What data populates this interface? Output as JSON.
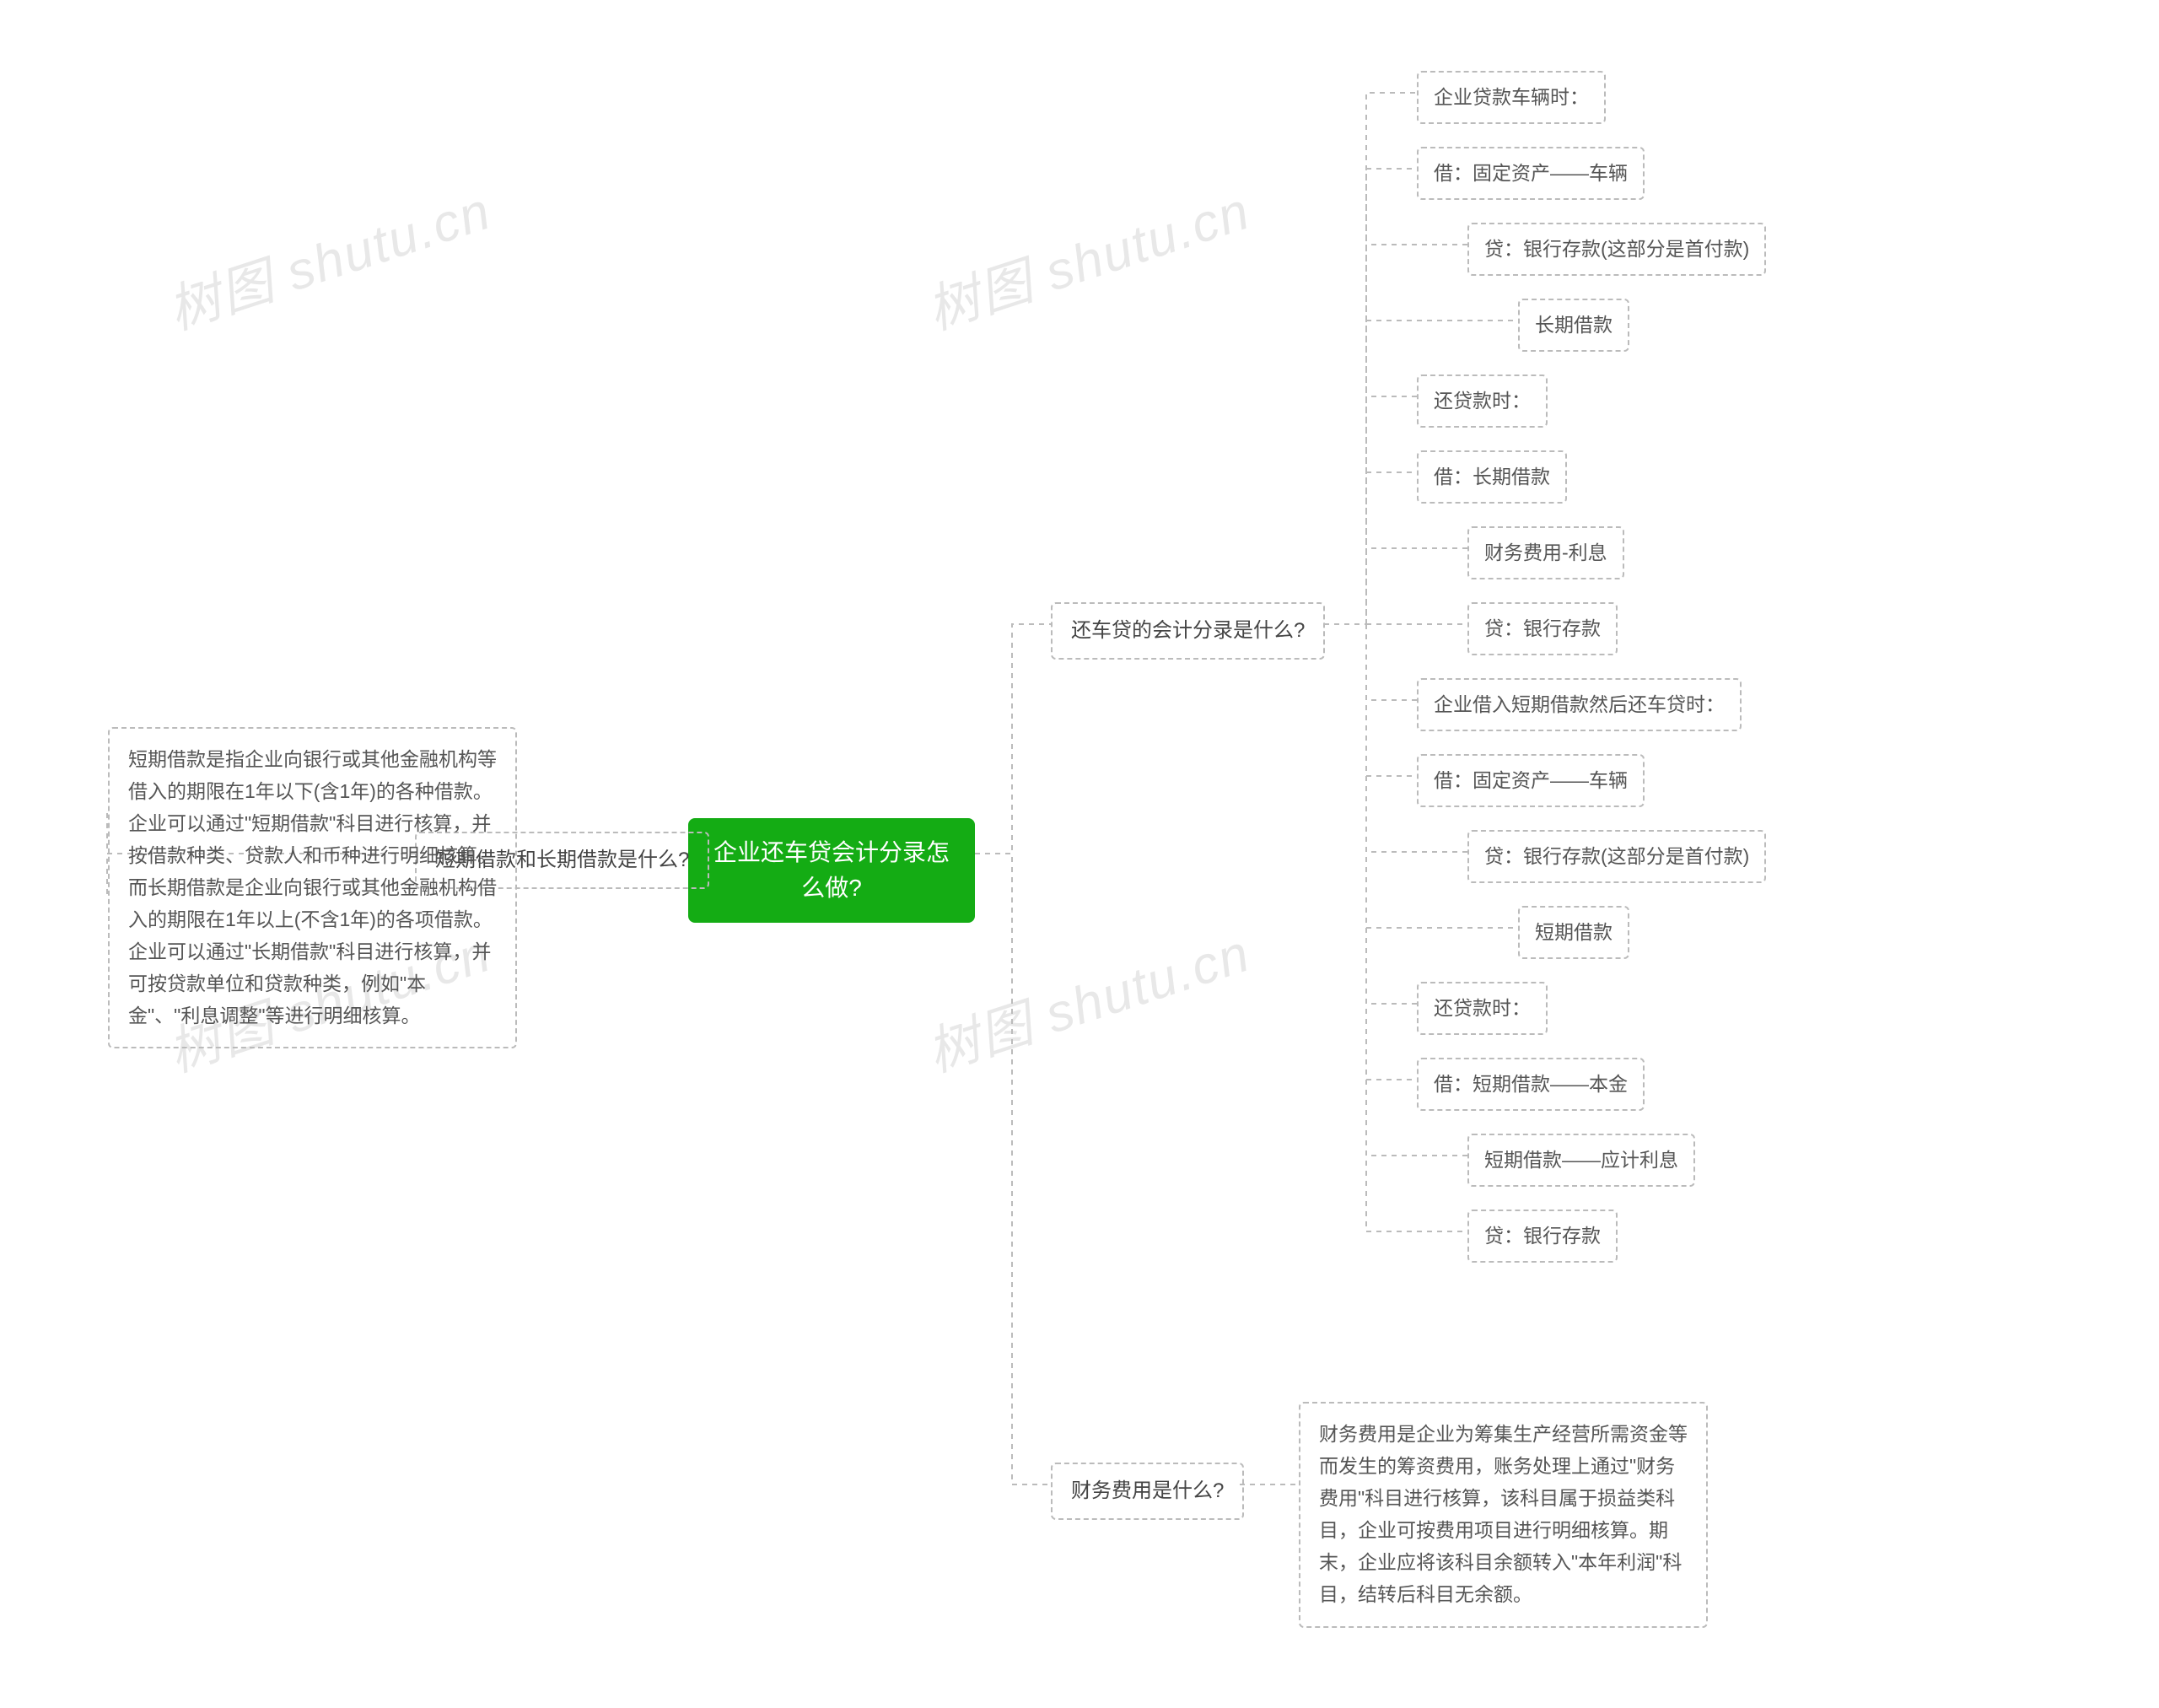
{
  "watermark": "树图 shutu.cn",
  "root": "企业还车贷会计分录怎么做?",
  "left": {
    "branch": "短期借款和长期借款是什么?",
    "desc": "短期借款是指企业向银行或其他金融机构等借入的期限在1年以下(含1年)的各种借款。企业可以通过\"短期借款\"科目进行核算，并按借款种类、贷款人和币种进行明细核算。而长期借款是企业向银行或其他金融机构借入的期限在1年以上(不含1年)的各项借款。企业可以通过\"长期借款\"科目进行核算，并可按贷款单位和贷款种类，例如\"本金\"、\"利息调整\"等进行明细核算。"
  },
  "right": {
    "branch1": "还车贷的会计分录是什么?",
    "leaves": [
      "企业贷款车辆时：",
      "借：固定资产——车辆",
      "贷：银行存款(这部分是首付款)",
      "长期借款",
      "还贷款时：",
      "借：长期借款",
      "财务费用-利息",
      "贷：银行存款",
      "企业借入短期借款然后还车贷时：",
      "借：固定资产——车辆",
      "贷：银行存款(这部分是首付款)",
      "短期借款",
      "还贷款时：",
      "借：短期借款——本金",
      "短期借款——应计利息",
      "贷：银行存款"
    ],
    "branch2": "财务费用是什么?",
    "desc2": "财务费用是企业为筹集生产经营所需资金等而发生的筹资费用，账务处理上通过\"财务费用\"科目进行核算，该科目属于损益类科目，企业可按费用项目进行明细核算。期末，企业应将该科目余额转入\"本年利润\"科目，结转后科目无余额。"
  }
}
